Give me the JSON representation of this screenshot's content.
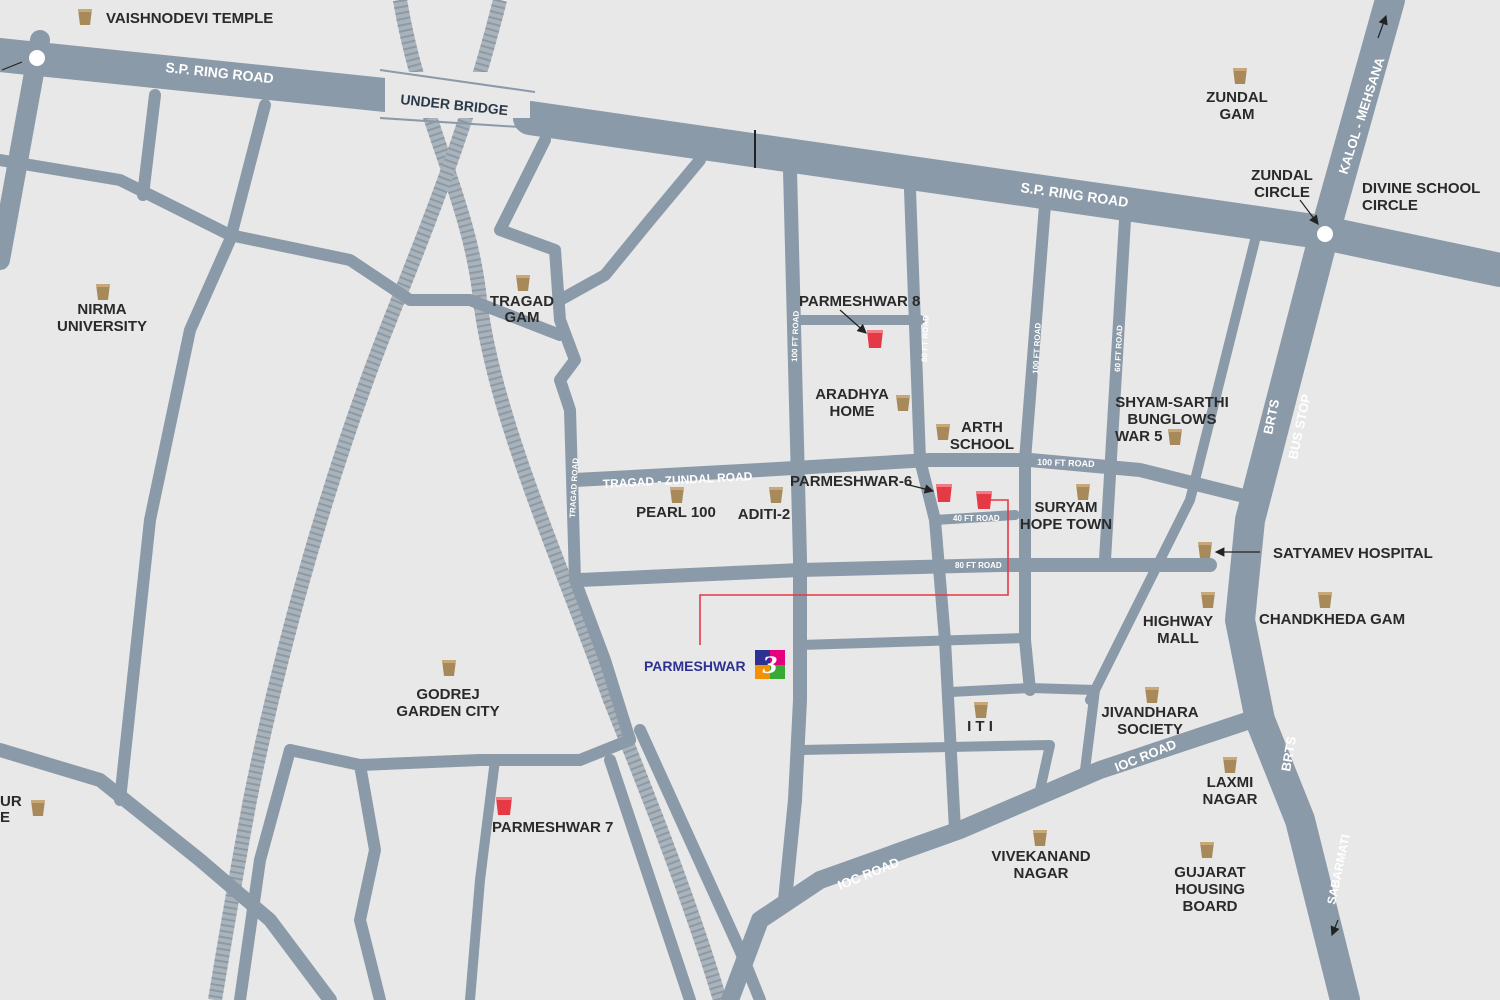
{
  "colors": {
    "background": "#e8e8e8",
    "road": "#8b9aa8",
    "rail": "#a9b3bc",
    "landmark_icon": "#a88a5a",
    "project_icon": "#e63946",
    "route_line": "#e63946",
    "brand_text": "#2e3192"
  },
  "roads": {
    "sp_ring_left": "S.P. RING ROAD",
    "sp_ring_right": "S.P. RING ROAD",
    "under_bridge": "UNDER BRIDGE",
    "kalol_mehsana": "KALOL - MEHSANA",
    "tragad_zundal": "TRAGAD - ZUNDAL ROAD",
    "tragad_road": "TRAGAD ROAD",
    "ft100_a": "100 FT ROAD",
    "ft80_a": "80 FT ROAD",
    "ft100_b": "100 FT ROAD",
    "ft60": "60 FT ROAD",
    "ft100_h": "100 FT ROAD",
    "ft40": "40 FT ROAD",
    "ft80_h": "80 FT ROAD",
    "brts_top": "BRTS",
    "bus_stop": "BUS STOP",
    "brts_bottom": "BRTS",
    "ioc_right": "IOC ROAD",
    "ioc_left": "IOC ROAD",
    "sabarmati": "SABARMATI"
  },
  "landmarks": {
    "vaishnodevi": "VAISHNODEVI TEMPLE",
    "zundal_gam_1": "ZUNDAL",
    "zundal_gam_2": "GAM",
    "zundal_circle_1": "ZUNDAL",
    "zundal_circle_2": "CIRCLE",
    "divine_1": "DIVINE SCHOOL",
    "divine_2": "CIRCLE",
    "nirma_1": "NIRMA",
    "nirma_2": "UNIVERSITY",
    "tragad_1": "TRAGAD",
    "tragad_2": "GAM",
    "aradhya_1": "ARADHYA",
    "aradhya_2": "HOME",
    "arth_1": "ARTH",
    "arth_2": "SCHOOL",
    "shyam_1": "SHYAM-SARTHI",
    "shyam_2": "BUNGLOWS",
    "shyam_3": "WAR 5",
    "pearl": "PEARL 100",
    "aditi": "ADITI-2",
    "suryam_1": "SURYAM",
    "suryam_2": "HOPE TOWN",
    "satyamev": "SATYAMEV HOSPITAL",
    "highway_1": "HIGHWAY",
    "highway_2": "MALL",
    "chandkheda": "CHANDKHEDA GAM",
    "godrej_1": "GODREJ",
    "godrej_2": "GARDEN CITY",
    "iti": "I T I",
    "jivandhara_1": "JIVANDHARA",
    "jivandhara_2": "SOCIETY",
    "laxmi_1": "LAXMI",
    "laxmi_2": "NAGAR",
    "vivekanand_1": "VIVEKANAND",
    "vivekanand_2": "NAGAR",
    "gujarat_1": "GUJARAT",
    "gujarat_2": "HOUSING",
    "gujarat_3": "BOARD",
    "left_cut_1": "UR",
    "left_cut_2": "E"
  },
  "projects": {
    "p8": "PARMESHWAR 8",
    "p6": "PARMESHWAR-6",
    "p7": "PARMESHWAR 7",
    "brand_name": "PARMESHWAR",
    "brand_number": "3"
  },
  "icons": {
    "landmark": "building-marker-icon",
    "project": "project-marker-icon",
    "circle": "roundabout-icon"
  }
}
